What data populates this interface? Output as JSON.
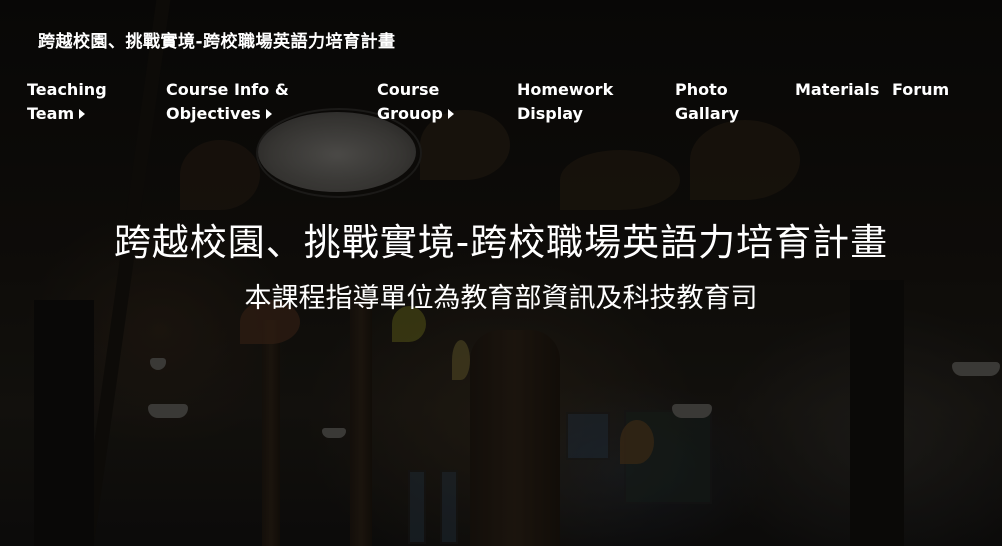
{
  "site": {
    "title": "跨越校園、挑戰實境-跨校職場英語力培育計畫"
  },
  "nav": {
    "items": [
      {
        "line1": "Teaching",
        "line2": "Team",
        "has_submenu": true
      },
      {
        "line1": "Course Info &",
        "line2": "Objectives",
        "has_submenu": true
      },
      {
        "line1": "Course",
        "line2": "Grouop",
        "has_submenu": true
      },
      {
        "line1": "Homework",
        "line2": "Display",
        "has_submenu": false
      },
      {
        "line1": "Photo",
        "line2": "Gallary",
        "has_submenu": false
      },
      {
        "line1": "Materials",
        "line2": "",
        "has_submenu": false
      },
      {
        "line1": "Forum",
        "line2": "",
        "has_submenu": false
      }
    ],
    "submenu_icon": "caret-right-icon"
  },
  "hero": {
    "title": "跨越校園、挑戰實境-跨校職場英語力培育計畫",
    "subtitle": "本課程指導單位為教育部資訊及科技教育司"
  },
  "colors": {
    "text": "#ffffff",
    "background": "#0b0b0a"
  }
}
